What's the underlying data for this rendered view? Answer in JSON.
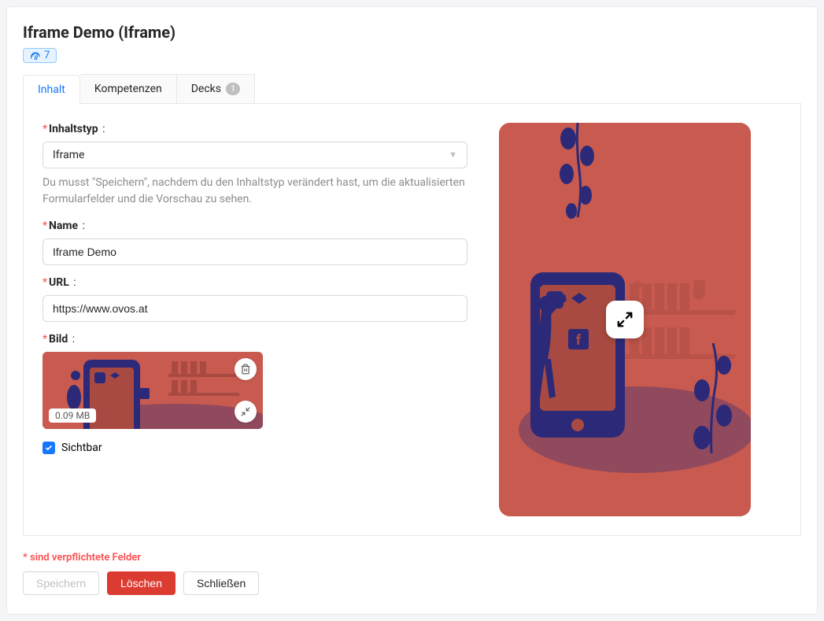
{
  "header": {
    "title": "Iframe Demo (Iframe)",
    "badge_count": "7"
  },
  "tabs": {
    "inhalt": "Inhalt",
    "kompetenzen": "Kompetenzen",
    "decks": "Decks",
    "decks_count": "1"
  },
  "form": {
    "inhaltstyp_label": "Inhaltstyp",
    "inhaltstyp_value": "Iframe",
    "inhaltstyp_help": "Du musst \"Speichern\", nachdem du den Inhaltstyp verändert hast, um die aktualisierten Formularfelder und die Vorschau zu sehen.",
    "name_label": "Name",
    "name_value": "Iframe Demo",
    "url_label": "URL",
    "url_value": "https://www.ovos.at",
    "bild_label": "Bild",
    "bild_size": "0.09 MB",
    "sichtbar_label": "Sichtbar"
  },
  "footer": {
    "required_note": "* sind verpflichtete Felder",
    "save": "Speichern",
    "delete": "Löschen",
    "close": "Schließen"
  },
  "colors": {
    "illustration_bg": "#c85a4f",
    "illustration_dark": "#2c2a78"
  }
}
